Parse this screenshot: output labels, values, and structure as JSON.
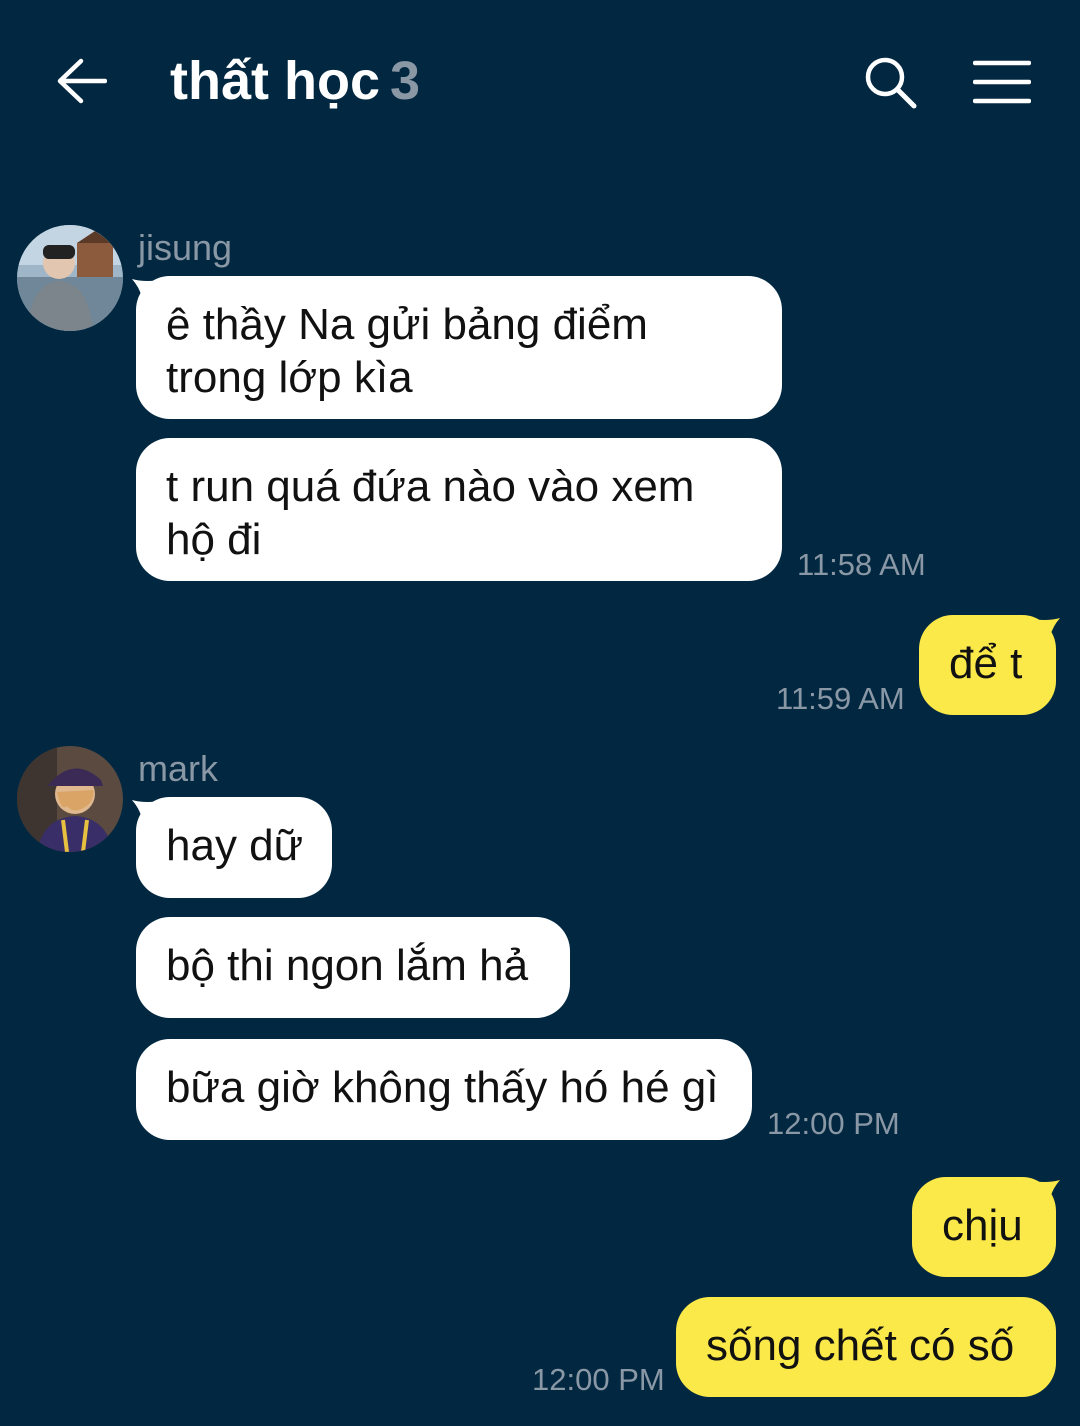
{
  "header": {
    "back_icon": "arrow-left-icon",
    "title": "thất học",
    "member_count": "3",
    "search_icon": "search-icon",
    "menu_icon": "menu-icon"
  },
  "colors": {
    "background": "#022841",
    "incoming_bubble": "#ffffff",
    "outgoing_bubble": "#fbe94a",
    "meta_text": "#8a98a6"
  },
  "messages": {
    "jisung": {
      "sender": "jisung",
      "bubble1": {
        "line1": "ê thầy Na gửi bảng điểm",
        "line2": "trong lớp kìa"
      },
      "bubble2": {
        "line1": "t run quá đứa nào vào xem",
        "line2": "hộ đi"
      },
      "time": "11:58 AM"
    },
    "me1": {
      "text": "để t",
      "time": "11:59 AM"
    },
    "mark": {
      "sender": "mark",
      "bubble1": "hay dữ",
      "bubble2": "bộ thi ngon lắm hả",
      "bubble3": "bữa giờ không thấy hó hé gì",
      "time": "12:00 PM"
    },
    "me2": {
      "bubble1": "chịu",
      "bubble2": "sống chết có số",
      "time": "12:00 PM"
    }
  }
}
